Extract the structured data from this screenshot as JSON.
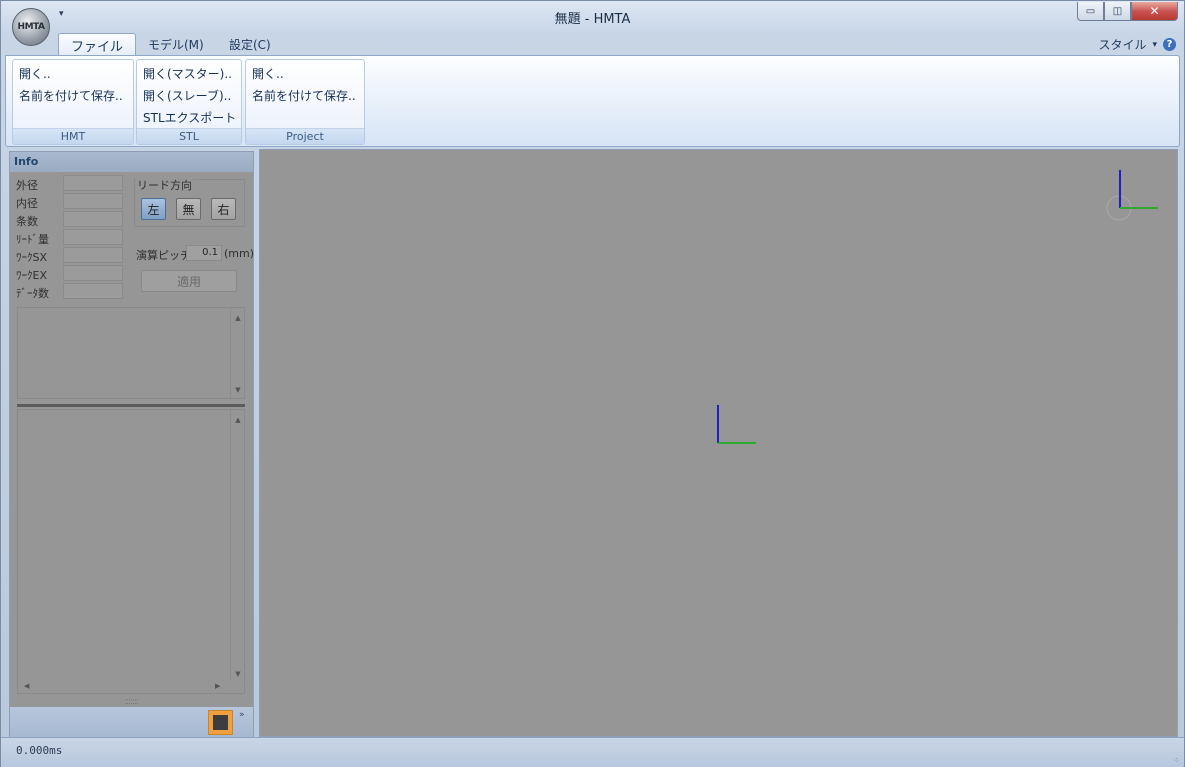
{
  "window": {
    "title": "無題 - HMTA",
    "orb_text": "HMTA",
    "qat_arrow": "▾",
    "min_glyph": "▭",
    "max_glyph": "◫",
    "close_glyph": "✕"
  },
  "ribbon": {
    "tabs": [
      {
        "label": "ファイル",
        "active": true
      },
      {
        "label": "モデル(M)",
        "active": false
      },
      {
        "label": "設定(C)",
        "active": false
      }
    ],
    "style_label": "スタイル",
    "style_arrow": "▾",
    "help_glyph": "?",
    "groups": [
      {
        "name": "HMT",
        "items": [
          "開く..",
          "名前を付けて保存.."
        ]
      },
      {
        "name": "STL",
        "items": [
          "開く(マスター)..",
          "開く(スレーブ)..",
          "STLエクスポート"
        ]
      },
      {
        "name": "Project",
        "items": [
          "開く..",
          "名前を付けて保存.."
        ]
      }
    ]
  },
  "info_panel": {
    "header": "Info",
    "fields": [
      {
        "label": "外径",
        "value": ""
      },
      {
        "label": "内径",
        "value": ""
      },
      {
        "label": "条数",
        "value": ""
      },
      {
        "label": "ﾘｰﾄﾞ量",
        "value": ""
      },
      {
        "label": "ﾜｰｸSX",
        "value": ""
      },
      {
        "label": "ﾜｰｸEX",
        "value": ""
      },
      {
        "label": "ﾃﾞｰﾀ数",
        "value": ""
      }
    ],
    "lead_direction": {
      "title": "リード方向",
      "buttons": [
        {
          "label": "左",
          "active": true
        },
        {
          "label": "無",
          "active": false
        },
        {
          "label": "右",
          "active": false
        }
      ]
    },
    "pitch": {
      "label": "演算ピッチ",
      "value": "0.1",
      "unit": "(mm)"
    },
    "apply_label": "適用",
    "scroll_up": "▲",
    "scroll_down": "▼",
    "scroll_left": "◀",
    "scroll_right": "▶",
    "grip": "⁚⁚⁚⁚⁚⁚⁚",
    "overflow": "»"
  },
  "status_bar": {
    "text": "0.000ms",
    "grip": "⁘"
  },
  "colors": {
    "viewport_bg": "#969696",
    "axis_x": "#2ea82e",
    "axis_y": "#1f1fc8",
    "swatch_outer": "#f0a040",
    "swatch_inner": "#3d3d3d",
    "close_button": "#c75050"
  },
  "icons": {
    "app_orb": "hmta-logo-icon",
    "help": "help-icon",
    "color_swatch": "color-swatch-icon",
    "overflow": "chevron-double-right-icon"
  }
}
